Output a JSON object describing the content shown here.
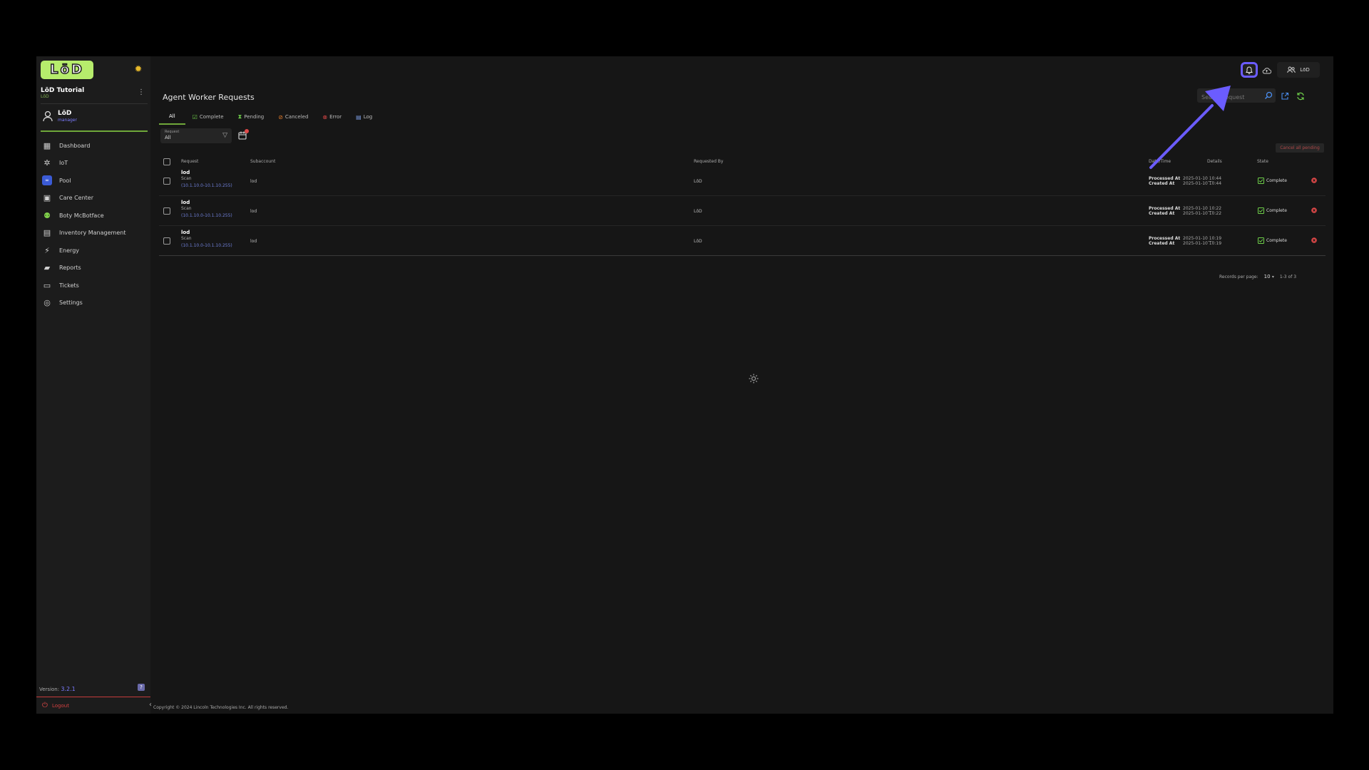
{
  "app": {
    "logo_text": "LōD",
    "theme_icon": "sun-icon"
  },
  "sidebar": {
    "org_name": "LōD Tutorial",
    "org_sub": "LōD",
    "user_name": "LōD",
    "user_role": "manager",
    "items": [
      {
        "label": "Dashboard",
        "icon": "dashboard-icon"
      },
      {
        "label": "IoT",
        "icon": "iot-icon"
      },
      {
        "label": "Pool",
        "icon": "pool-icon"
      },
      {
        "label": "Care Center",
        "icon": "care-center-icon"
      },
      {
        "label": "Boty McBotface",
        "icon": "bot-icon"
      },
      {
        "label": "Inventory Management",
        "icon": "inventory-icon"
      },
      {
        "label": "Energy",
        "icon": "energy-icon"
      },
      {
        "label": "Reports",
        "icon": "reports-icon"
      },
      {
        "label": "Tickets",
        "icon": "tickets-icon"
      },
      {
        "label": "Settings",
        "icon": "settings-icon"
      }
    ],
    "version_label": "Version:",
    "version_value": "3.2.1",
    "logout_label": "Logout"
  },
  "topbar": {
    "user_label": "LōD"
  },
  "page": {
    "title": "Agent Worker Requests",
    "search_placeholder": "Search request",
    "tabs": [
      {
        "label": "All"
      },
      {
        "label": "Complete"
      },
      {
        "label": "Pending"
      },
      {
        "label": "Canceled"
      },
      {
        "label": "Error"
      },
      {
        "label": "Log"
      }
    ],
    "filter_label": "Request",
    "filter_value": "All",
    "cancel_all_label": "Cancel all pending"
  },
  "table": {
    "headers": {
      "request": "Request",
      "subaccount": "Subaccount",
      "requested_by": "Requested By",
      "datetime": "Date/Time",
      "details": "Details",
      "state": "State"
    },
    "rows": [
      {
        "title": "lod",
        "type": "Scan",
        "range": "(10.1.10.0-10.1.10.255)",
        "subaccount": "lod",
        "requested_by": "LōD",
        "processed_label": "Processed At",
        "created_label": "Created At",
        "processed_at": "2025-01-10 10:44",
        "created_at": "2025-01-10 10:44",
        "details": "---",
        "state": "Complete"
      },
      {
        "title": "lod",
        "type": "Scan",
        "range": "(10.1.10.0-10.1.10.255)",
        "subaccount": "lod",
        "requested_by": "LōD",
        "processed_label": "Processed At",
        "created_label": "Created At",
        "processed_at": "2025-01-10 10:22",
        "created_at": "2025-01-10 10:22",
        "details": "---",
        "state": "Complete"
      },
      {
        "title": "lod",
        "type": "Scan",
        "range": "(10.1.10.0-10.1.10.255)",
        "subaccount": "lod",
        "requested_by": "LōD",
        "processed_label": "Processed At",
        "created_label": "Created At",
        "processed_at": "2025-01-10 10:19",
        "created_at": "2025-01-10 10:19",
        "details": "---",
        "state": "Complete"
      }
    ],
    "records_per_page_label": "Records per page:",
    "records_per_page": "10",
    "range_text": "1-3 of 3"
  },
  "footer": {
    "copyright": "Copyright © 2024 Lincoln Technologies Inc. All rights reserved."
  },
  "colors": {
    "accent_green": "#6fa83a",
    "logo_green": "#b6ec6c",
    "highlight_purple": "#6b5cff",
    "danger_red": "#e04848",
    "link_blue": "#6f7fd8"
  }
}
